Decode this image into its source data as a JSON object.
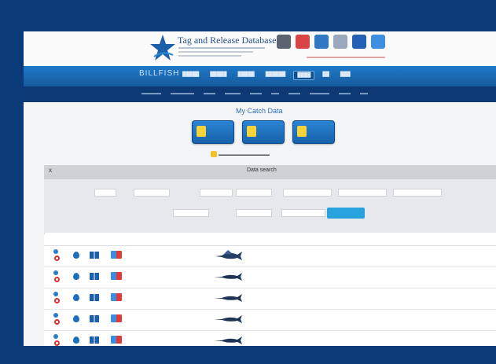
{
  "site": {
    "title": "Tag and Release Database",
    "brand": "BILLFISH"
  },
  "nav": {
    "items": [
      "",
      "",
      "",
      "",
      "",
      "",
      ""
    ],
    "active_index": 5
  },
  "subnav": {
    "items": [
      "",
      "",
      "",
      "",
      "",
      "",
      "",
      "",
      "",
      ""
    ]
  },
  "page": {
    "title": "My Catch Data"
  },
  "action_buttons": [
    {
      "label": "",
      "icon": "dollar-icon"
    },
    {
      "label": "",
      "icon": "dollar-icon"
    },
    {
      "label": "",
      "icon": "tag-icon"
    }
  ],
  "panel": {
    "title": "Data search",
    "close": "x"
  },
  "rows": [
    {
      "species_icon": "sailfish-icon"
    },
    {
      "species_icon": "marlin-icon"
    },
    {
      "species_icon": "marlin-icon"
    },
    {
      "species_icon": "marlin-icon"
    },
    {
      "species_icon": "marlin-icon"
    }
  ],
  "colors": {
    "frame": "#0b3a78",
    "navbar": "#1f79c8",
    "subnav": "#0d3a74",
    "accent_button": "#29a3e0"
  }
}
